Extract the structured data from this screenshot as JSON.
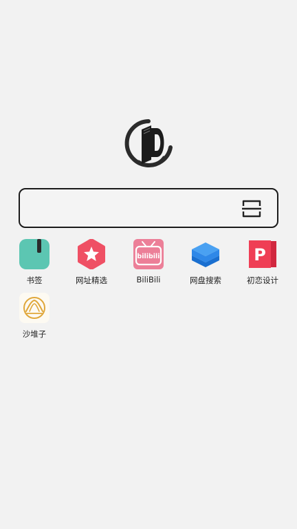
{
  "colors": {
    "bookmark": "#5cc6b2",
    "favorites": "#ef5064",
    "bilibili": "#ec7f98",
    "netdisk": "#2f88e8",
    "design": "#ef3e55",
    "shaduizi": "#e0a73a"
  },
  "logo": {
    "icon": "book-d-logo-icon"
  },
  "search": {
    "scan_icon": "scan-icon"
  },
  "apps": [
    {
      "label": "书签",
      "icon": "bookmark-icon"
    },
    {
      "label": "网址精选",
      "icon": "star-hexagon-icon"
    },
    {
      "label": "BiliBili",
      "icon": "bilibili-tv-icon",
      "icon_text": "bilibili"
    },
    {
      "label": "网盘搜索",
      "icon": "layers-icon"
    },
    {
      "label": "初恋设计",
      "icon": "p-logo-icon",
      "icon_text": "P"
    },
    {
      "label": "沙堆子",
      "icon": "sand-pile-icon"
    }
  ]
}
